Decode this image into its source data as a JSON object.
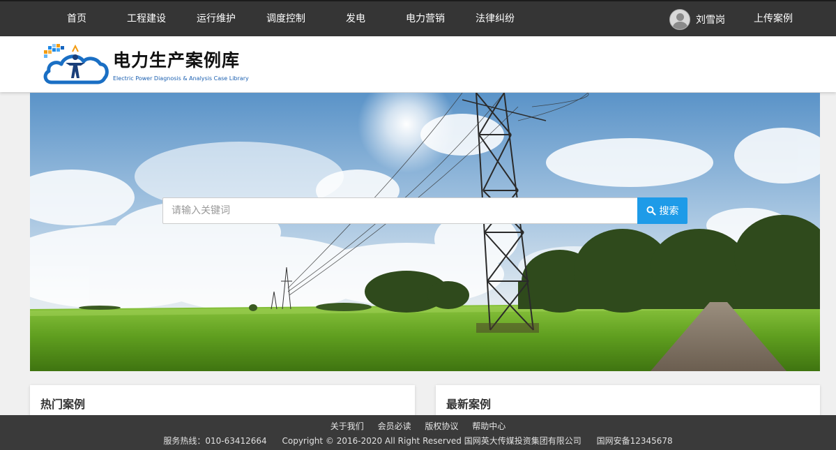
{
  "nav": {
    "items": [
      "首页",
      "工程建设",
      "运行维护",
      "调度控制",
      "发电",
      "电力营销",
      "法律纠纷"
    ],
    "user_name": "刘雪岗",
    "upload_label": "上传案例"
  },
  "brand": {
    "title": "电力生产案例库",
    "subtitle": "Electric Power Diagnosis & Analysis Case Library"
  },
  "search": {
    "placeholder": "请输入关键词",
    "button_label": "搜索"
  },
  "sections": {
    "hot_title": "热门案例",
    "latest_title": "最新案例"
  },
  "footer": {
    "links": [
      "关于我们",
      "会员必读",
      "版权协议",
      "帮助中心"
    ],
    "hotline": "服务热线：010-63412664",
    "copyright": "Copyright © 2016-2020 All Right Reserved 国网英大传媒投资集团有限公司",
    "icp": "国网安备12345678"
  },
  "colors": {
    "topbar": "#353535",
    "accent": "#1e9be8",
    "footer": "#3a3a3a"
  }
}
